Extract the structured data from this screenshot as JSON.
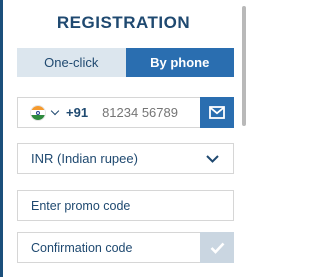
{
  "form": {
    "title": "REGISTRATION"
  },
  "tabs": [
    {
      "label": "One-click",
      "active": false
    },
    {
      "label": "By phone",
      "active": true
    }
  ],
  "phone": {
    "country_icon": "india-flag-icon",
    "dial_code": "+91",
    "number_placeholder": "81234 56789"
  },
  "currency": {
    "selected": "INR (Indian rupee)"
  },
  "promo": {
    "placeholder": "Enter promo code"
  },
  "confirmation": {
    "placeholder": "Confirmation code"
  },
  "colors": {
    "title": "#1f4970",
    "accent": "#2a6eb0",
    "tab_inactive_bg": "#dce6ee",
    "confirm_disabled": "#cad6e1"
  }
}
